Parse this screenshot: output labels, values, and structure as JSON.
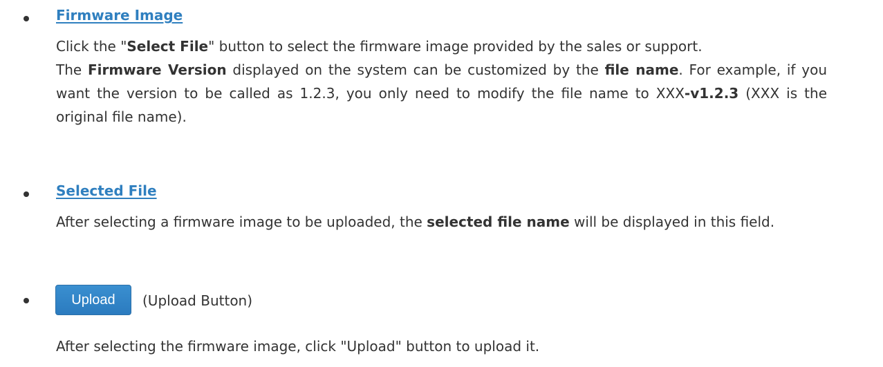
{
  "items": [
    {
      "heading": "Firmware Image",
      "line1_pre": "Click the \"",
      "line1_bold": "Select File",
      "line1_post": "\" button to select the firmware image provided by the sales or support.",
      "para_pre": "The ",
      "para_bold1": "Firmware Version",
      "para_mid": " displayed on the system can be customized by the ",
      "para_bold2": "file name",
      "para_post": ". For example, if you want the version to be called as 1.2.3, you only need to modify the file name to XXX",
      "para_bold3": "-v1.2.3",
      "para_end": " (XXX is the original file name)."
    },
    {
      "heading": "Selected File",
      "para_pre": "After selecting a firmware image to be uploaded, the ",
      "para_bold": "selected file name",
      "para_post": " will be displayed in this field."
    },
    {
      "button_label": "Upload",
      "caption": "(Upload Button)",
      "description": "After selecting the firmware image, click \"Upload\" button to upload it."
    }
  ]
}
